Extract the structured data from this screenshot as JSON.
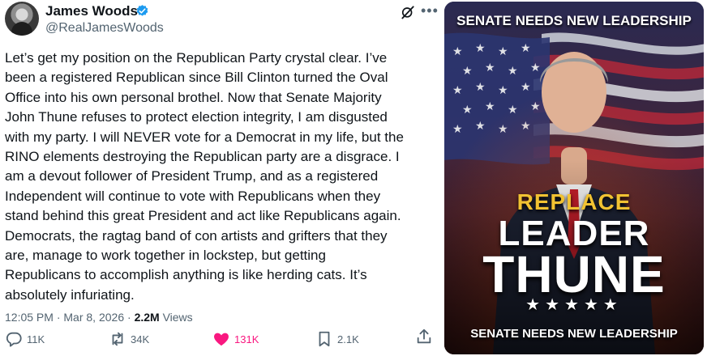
{
  "author": {
    "display_name": "James Woods",
    "handle": "@RealJamesWoods",
    "verified": true
  },
  "tweet": {
    "text": "Let’s get my position on the Republican Party crystal clear. I’ve\nbeen a registered Republican since Bill Clinton turned the Oval\nOffice into his own personal brothel. Now that Senate Majority\nJohn Thune refuses to protect election integrity, I am disgusted\nwith my party. I will NEVER vote for a Democrat in my life, but the\nRINO elements destroying the Republican party are a disgrace. I\nam a devout follower of President Trump, and as a registered\nIndependent will continue to vote with Republicans when they\nstand behind this great President and act like Republicans again.\nDemocrats, the ragtag band of con artists and grifters that they\nare, manage to work together in lockstep, but getting\nRepublicans to accomplish anything is like herding cats. It’s\nabsolutely infuriating.",
    "time": "12:05 PM",
    "date": "Mar 8, 2026",
    "views_count": "2.2M",
    "views_label": "Views"
  },
  "actions": {
    "replies": "11K",
    "reposts": "34K",
    "likes": "131K",
    "bookmarks": "2.1K"
  },
  "icons": {
    "verified": "verified-badge-icon",
    "grok": "grok-icon",
    "more": "more-icon",
    "reply": "reply-icon",
    "repost": "repost-icon",
    "like": "heart-icon",
    "bookmark": "bookmark-icon",
    "share": "share-icon"
  },
  "poster": {
    "top_text": "SENATE NEEDS NEW LEADERSHIP",
    "line1": "REPLACE",
    "line2": "LEADER",
    "line3": "THUNE",
    "stars": "★★★★★",
    "bottom_text": "SENATE NEEDS NEW LEADERSHIP"
  },
  "colors": {
    "text": "#0f1419",
    "secondary": "#536471",
    "verified": "#1d9bf0",
    "like": "#f91880",
    "poster_gold": "#f1c232"
  }
}
